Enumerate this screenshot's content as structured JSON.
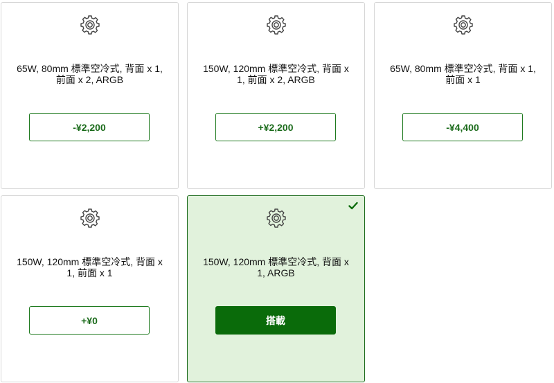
{
  "options": [
    {
      "title": "65W, 80mm 標準空冷式, 背面 x 1, 前面 x 2, ARGB",
      "price": "-¥2,200",
      "icon": "gear-icon"
    },
    {
      "title": "150W, 120mm 標準空冷式, 背面 x 1, 前面 x 2, ARGB",
      "price": "+¥2,200",
      "icon": "gear-icon"
    },
    {
      "title": "65W, 80mm 標準空冷式, 背面 x 1, 前面 x 1",
      "price": "-¥4,400",
      "icon": "gear-icon"
    },
    {
      "title": "150W, 120mm 標準空冷式, 背面 x 1, 前面 x 1",
      "price": "+¥0",
      "icon": "gear-icon"
    },
    {
      "title": "150W, 120mm 標準空冷式, 背面 x 1, ARGB",
      "price": "搭載",
      "icon": "gear-icon",
      "selected": true,
      "check_icon": "checkmark-icon"
    }
  ],
  "colors": {
    "accent_green": "#0a6b0a",
    "selected_bg": "#e1f2dc",
    "border": "#d6d6d6"
  }
}
